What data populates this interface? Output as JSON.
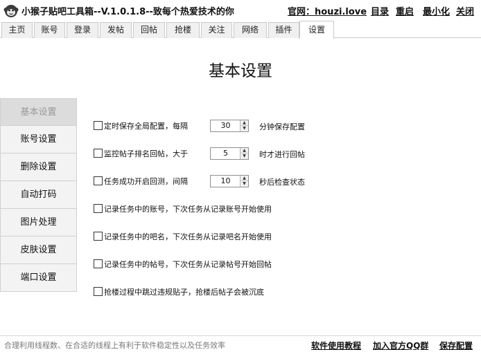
{
  "window": {
    "title": "小猴子贴吧工具箱--V.1.0.1.8--致每个热爱技术的你",
    "website": "官网：houzi.love",
    "links": [
      "目录",
      "重启",
      "最小化",
      "关闭"
    ]
  },
  "tabs": [
    {
      "label": "主页",
      "active": false
    },
    {
      "label": "账号",
      "active": false
    },
    {
      "label": "登录",
      "active": false
    },
    {
      "label": "发帖",
      "active": false
    },
    {
      "label": "回帖",
      "active": false
    },
    {
      "label": "抢楼",
      "active": false
    },
    {
      "label": "关注",
      "active": false
    },
    {
      "label": "网络",
      "active": false
    },
    {
      "label": "插件",
      "active": false
    },
    {
      "label": "设置",
      "active": true
    }
  ],
  "page_title": "基本设置",
  "sidebar": [
    {
      "label": "基本设置",
      "active": true
    },
    {
      "label": "账号设置",
      "active": false
    },
    {
      "label": "删除设置",
      "active": false
    },
    {
      "label": "自动打码",
      "active": false
    },
    {
      "label": "图片处理",
      "active": false
    },
    {
      "label": "皮肤设置",
      "active": false
    },
    {
      "label": "端口设置",
      "active": false
    }
  ],
  "settings": [
    {
      "label": "定时保存全局配置，每隔",
      "checked": false,
      "value": "30",
      "suffix": "分钟保存配置"
    },
    {
      "label": "监控帖子排名回帖，大于",
      "checked": false,
      "value": "5",
      "suffix": "时才进行回帖"
    },
    {
      "label": "任务成功开启回测，间隔",
      "checked": false,
      "value": "10",
      "suffix": "秒后检查状态"
    },
    {
      "label": "记录任务中的账号，下次任务从记录账号开始使用",
      "checked": false
    },
    {
      "label": "记录任务中的吧名，下次任务从记录吧名开始使用",
      "checked": false
    },
    {
      "label": "记录任务中的帖号，下次任务从记录帖号开始回帖",
      "checked": false
    },
    {
      "label": "抢楼过程中跳过违规贴子，抢楼后帖子会被沉底",
      "checked": false
    }
  ],
  "status": {
    "text": "合理利用线程数、在合适的线程上有利于软件稳定性以及任务效率",
    "links": [
      "软件使用教程",
      "加入官方QQ群",
      "保存配置"
    ]
  },
  "icons": {
    "logo": "monkey-logo-icon",
    "spin_up": "spin-up-arrow-icon",
    "spin_down": "spin-down-arrow-icon"
  }
}
